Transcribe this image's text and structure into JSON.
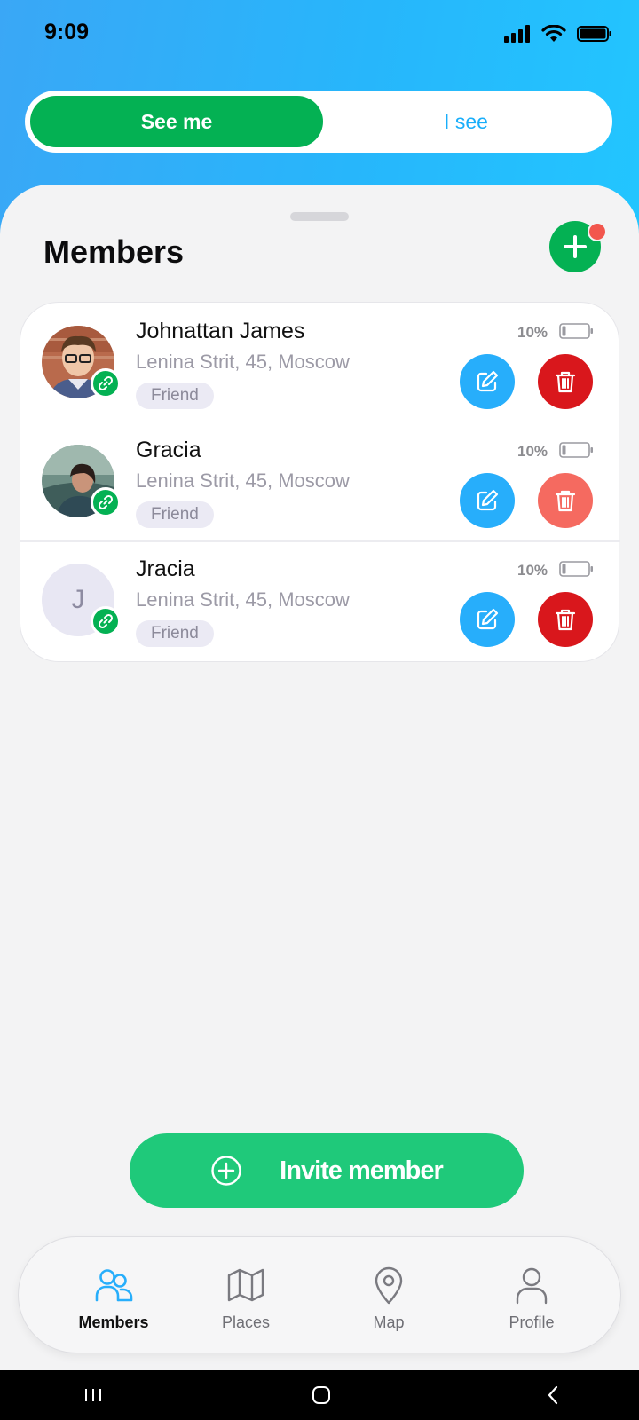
{
  "status_bar": {
    "time": "9:09"
  },
  "segment": {
    "active_label": "See me",
    "inactive_label": "I see"
  },
  "sheet": {
    "title": "Members"
  },
  "members": [
    {
      "name": "Johnattan James",
      "address": "Lenina Strit, 45, Moscow",
      "tag": "Friend",
      "battery": "10%",
      "avatar": "photo",
      "delete_color": "#d9171c"
    },
    {
      "name": "Gracia",
      "address": "Lenina Strit, 45, Moscow",
      "tag": "Friend",
      "battery": "10%",
      "avatar": "photo",
      "delete_color": "#f56a60"
    },
    {
      "name": "Jracia",
      "address": "Lenina Strit, 45, Moscow",
      "tag": "Friend",
      "battery": "10%",
      "avatar": "J",
      "delete_color": "#d9171c"
    }
  ],
  "invite": {
    "label": "Invite member"
  },
  "tabs": [
    {
      "label": "Members",
      "icon": "members-icon",
      "active": true
    },
    {
      "label": "Places",
      "icon": "map-fold-icon",
      "active": false
    },
    {
      "label": "Map",
      "icon": "location-pin-icon",
      "active": false
    },
    {
      "label": "Profile",
      "icon": "user-icon",
      "active": false
    }
  ],
  "colors": {
    "primary_green": "#04b153",
    "accent_blue": "#27aefb",
    "invite_green": "#1fc97a"
  }
}
